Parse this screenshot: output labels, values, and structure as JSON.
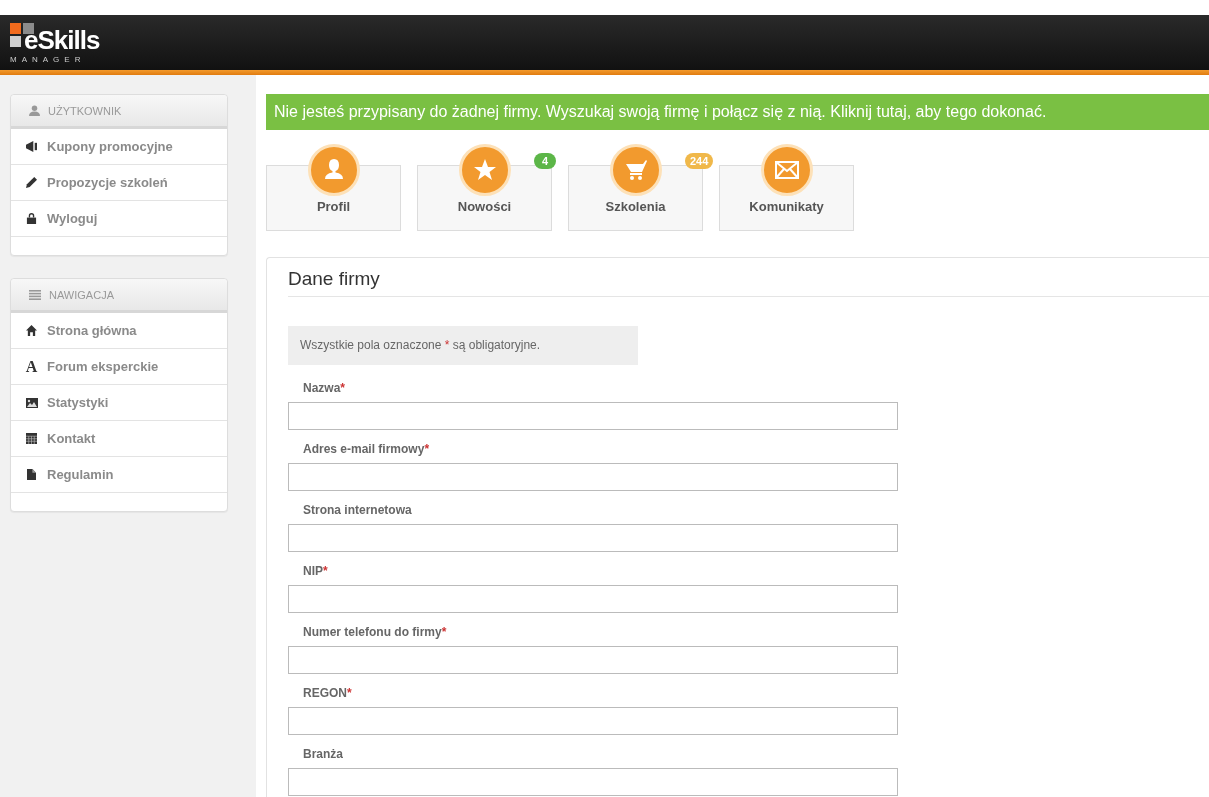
{
  "logo": {
    "word": "eSkills",
    "sub": "MANAGER"
  },
  "sidebar": [
    {
      "title": "UŻYTKOWNIK",
      "items": [
        {
          "label": "Kupony promocyjne"
        },
        {
          "label": "Propozycje szkoleń"
        },
        {
          "label": "Wyloguj"
        }
      ]
    },
    {
      "title": "NAWIGACJA",
      "items": [
        {
          "label": "Strona główna"
        },
        {
          "label": "Forum eksperckie",
          "glyph": "A"
        },
        {
          "label": "Statystyki"
        },
        {
          "label": "Kontakt"
        },
        {
          "label": "Regulamin"
        }
      ]
    }
  ],
  "banner": "Nie jesteś przypisany do żadnej firmy. Wyszukaj swoją firmę i połącz się z nią. Kliknij tutaj, aby tego dokonać.",
  "tiles": [
    {
      "label": "Profil"
    },
    {
      "label": "Nowości",
      "badge": "4",
      "color": "#5cb648"
    },
    {
      "label": "Szkolenia",
      "badge": "244",
      "color": "#f0b84a"
    },
    {
      "label": "Komunikaty"
    }
  ],
  "form": {
    "title": "Dane firmy",
    "note": {
      "before": "Wszystkie pola oznaczone",
      "marker": "*",
      "after": "są obligatoryjne."
    },
    "fields": [
      {
        "label": "Nazwa",
        "mark": "*"
      },
      {
        "label": "Adres e-mail firmowy",
        "mark": "*"
      },
      {
        "label": "Strona internetowa"
      },
      {
        "label": "NIP",
        "mark": "*"
      },
      {
        "label": "Numer telefonu do firmy",
        "mark": "*"
      },
      {
        "label": "REGON",
        "mark": "*"
      },
      {
        "label": "Branża"
      }
    ]
  }
}
